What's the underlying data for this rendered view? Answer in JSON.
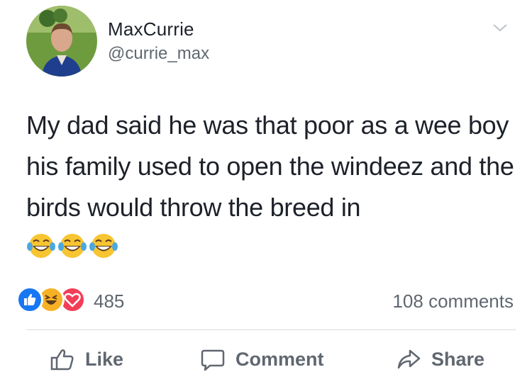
{
  "post": {
    "author_name": "MaxCurrie",
    "author_handle": "@currie_max",
    "text": "My dad said he was that poor as a wee boy his family used to open the windeez and the birds would throw the breed in",
    "emojis": [
      "laughing-tears-emoji",
      "laughing-tears-emoji",
      "laughing-tears-emoji"
    ]
  },
  "reactions": {
    "types": [
      "like-reaction-icon",
      "haha-reaction-icon",
      "love-reaction-icon"
    ],
    "count": "485",
    "comments": "108 comments"
  },
  "actions": {
    "like_label": "Like",
    "comment_label": "Comment",
    "share_label": "Share"
  },
  "colors": {
    "like_blue": "#1877f2",
    "love_red": "#f33e58",
    "haha_yellow": "#f7b125",
    "meta_gray": "#606770"
  }
}
